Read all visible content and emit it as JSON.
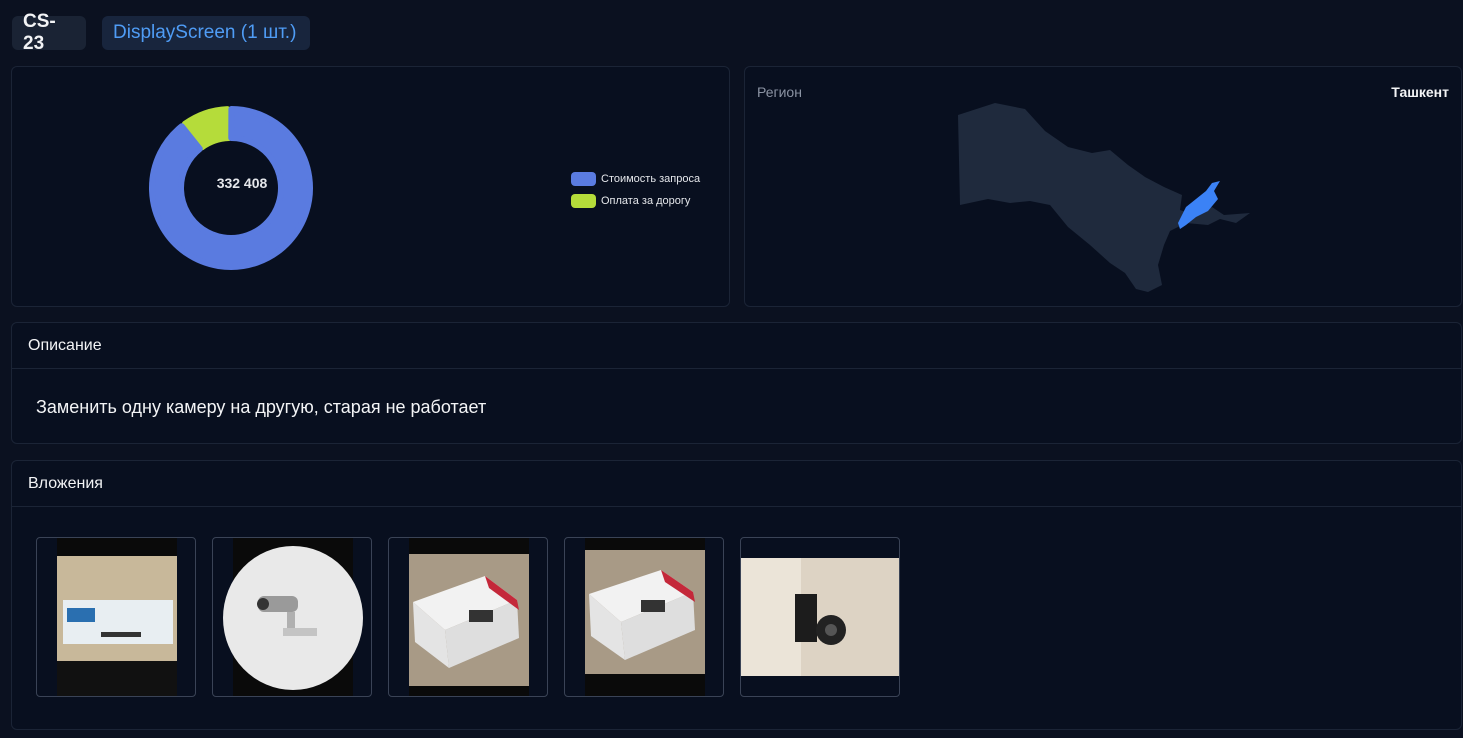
{
  "header": {
    "id_tag": "CS-23",
    "device_tag": "DisplayScreen (1 шт.)"
  },
  "chart_data": {
    "type": "pie",
    "center_label": "332 408",
    "series": [
      {
        "name": "Стоимость запроса",
        "share": 0.9,
        "color": "#5a7be0"
      },
      {
        "name": "Оплата за дорогу",
        "share": 0.1,
        "color": "#b5dc3a"
      }
    ]
  },
  "legend": {
    "items": [
      {
        "label": "Стоимость запроса",
        "color": "#5a7be0"
      },
      {
        "label": "Оплата за дорогу",
        "color": "#b5dc3a"
      }
    ]
  },
  "region": {
    "label": "Регион",
    "value": "Ташкент",
    "map_color": "#1f2a3d",
    "highlight_color": "#3b82f6"
  },
  "description": {
    "title": "Описание",
    "text": "Заменить одну камеру на другую, старая не работает"
  },
  "attachments": {
    "title": "Вложения",
    "items": [
      {
        "icon": "camera-box-photo"
      },
      {
        "icon": "bullet-camera-photo"
      },
      {
        "icon": "camera-box-photo"
      },
      {
        "icon": "camera-box-photo"
      },
      {
        "icon": "dome-camera-photo"
      }
    ]
  }
}
